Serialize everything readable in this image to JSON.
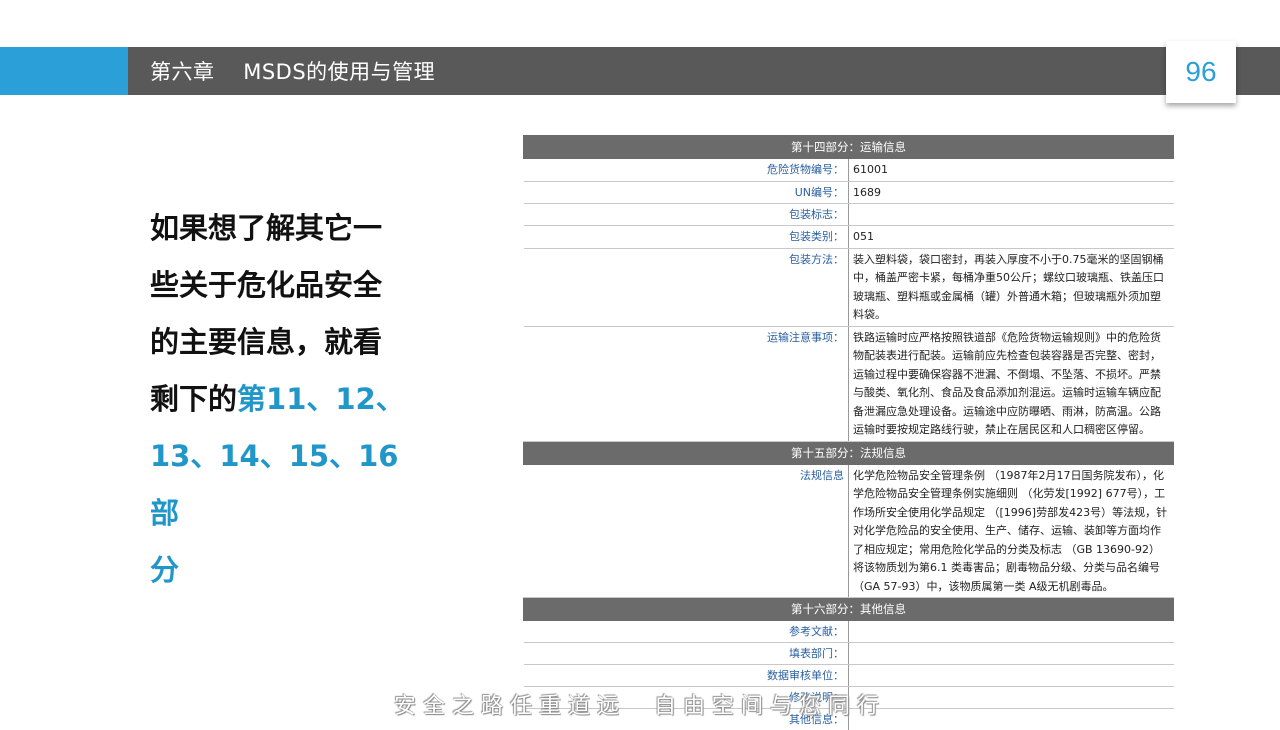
{
  "header": {
    "title": "第六章    MSDS的使用与管理",
    "page_number": "96"
  },
  "intro": {
    "line1": "如果想了解其它一",
    "line2": "些关于危化品安全",
    "line3": "的主要信息，就看",
    "line4_prefix": "剩下的",
    "line4_highlight": "第11、12、",
    "line5": "13、14、15、16部",
    "line6": "分"
  },
  "table": {
    "sec14": "第十四部分：运输信息",
    "rows14": [
      {
        "k": "危险货物编号：",
        "v": "61001"
      },
      {
        "k": "UN编号：",
        "v": "1689"
      },
      {
        "k": "包装标志：",
        "v": ""
      },
      {
        "k": "包装类别：",
        "v": "051"
      },
      {
        "k": "包装方法：",
        "v": "装入塑料袋，袋口密封，再装入厚度不小于0.75毫米的坚固钢桶中，桶盖严密卡紧，每桶净重50公斤；螺纹口玻璃瓶、铁盖压口玻璃瓶、塑料瓶或金属桶（罐）外普通木箱；但玻璃瓶外须加塑料袋。"
      },
      {
        "k": "运输注意事项：",
        "v": "铁路运输时应严格按照铁道部《危险货物运输规则》中的危险货物配装表进行配装。运输前应先检查包装容器是否完整、密封，运输过程中要确保容器不泄漏、不倒塌、不坠落、不损坏。严禁与酸类、氧化剂、食品及食品添加剂混运。运输时运输车辆应配备泄漏应急处理设备。运输途中应防曝晒、雨淋，防高温。公路运输时要按规定路线行驶，禁止在居民区和人口稠密区停留。"
      }
    ],
    "sec15": "第十五部分：法规信息",
    "rows15": [
      {
        "k": "法规信息",
        "v": "化学危险物品安全管理条例 （1987年2月17日国务院发布），化学危险物品安全管理条例实施细则 （化劳发[1992] 677号），工作场所安全使用化学品规定 （[1996]劳部发423号）等法规，针对化学危险品的安全使用、生产、储存、运输、装卸等方面均作了相应规定；常用危险化学品的分类及标志 （GB 13690-92）将该物质划为第6.1 类毒害品；剧毒物品分级、分类与品名编号（GA 57-93）中，该物质属第一类 A级无机剧毒品。"
      }
    ],
    "sec16": "第十六部分：其他信息",
    "rows16": [
      {
        "k": "参考文献：",
        "v": ""
      },
      {
        "k": "填表部门：",
        "v": ""
      },
      {
        "k": "数据审核单位：",
        "v": ""
      },
      {
        "k": "修改说明：",
        "v": ""
      },
      {
        "k": "其他信息：",
        "v": ""
      }
    ]
  },
  "footer": {
    "slogan": "安全之路任重道远  自由空间与您同行"
  },
  "colors": {
    "accent": "#2a9fd8",
    "bar": "#595959",
    "highlight": "#2196c8",
    "section_header": "#6b6b6b"
  }
}
